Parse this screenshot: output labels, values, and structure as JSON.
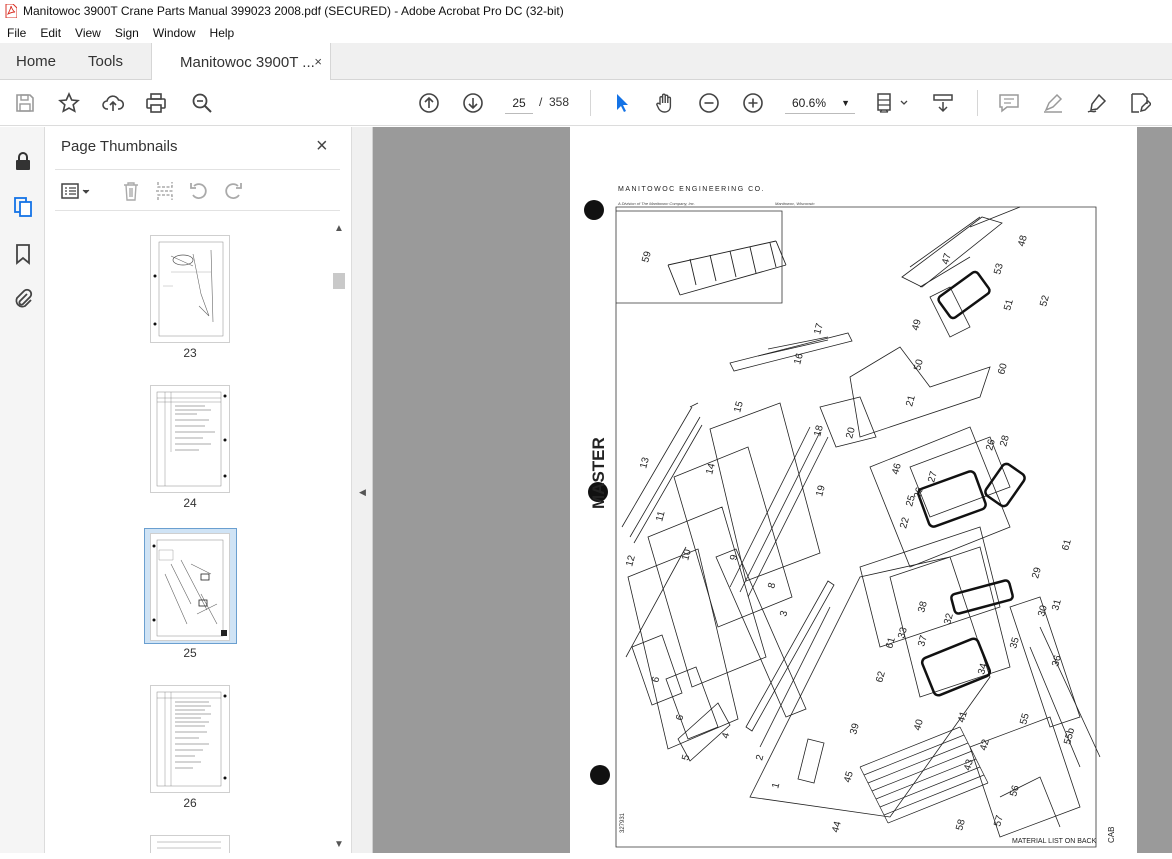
{
  "window": {
    "title": "Manitowoc 3900T Crane Parts Manual 399023 2008.pdf (SECURED) - Adobe Acrobat Pro DC (32-bit)"
  },
  "menu": [
    "File",
    "Edit",
    "View",
    "Sign",
    "Window",
    "Help"
  ],
  "tabs": {
    "home": "Home",
    "tools": "Tools",
    "document": "Manitowoc 3900T ...",
    "close": "×"
  },
  "toolbar": {
    "current_page": "25",
    "page_separator": "/",
    "total_pages": "358",
    "zoom": "60.6%",
    "icons": [
      "save-icon",
      "star-icon",
      "upload-icon",
      "print-icon",
      "search-zoom-icon",
      "page-up-icon",
      "page-down-icon",
      "select-pointer-icon",
      "hand-icon",
      "zoom-out-icon",
      "zoom-in-icon",
      "fit-page-icon",
      "scroll-mode-icon",
      "comment-icon",
      "highlight-icon",
      "sign-icon",
      "edit-pdf-icon"
    ]
  },
  "panel": {
    "title": "Page Thumbnails",
    "close": "×"
  },
  "thumbnails": [
    {
      "label": "23"
    },
    {
      "label": "24"
    },
    {
      "label": "25",
      "selected": true
    },
    {
      "label": "26"
    }
  ],
  "document": {
    "header": "MANITOWOC ENGINEERING CO.",
    "subheader_left": "A Division of The Manitowoc Company, Inc.",
    "subheader_right": "Manitowoc, Wisconsin",
    "stamp": "MASTER",
    "footer_note": "MATERIAL LIST ON BACK",
    "footer_right": "CAB",
    "drawing_number": "327931",
    "part_numbers": [
      "59",
      "17",
      "16",
      "15",
      "14",
      "13",
      "12",
      "11",
      "10",
      "9",
      "8",
      "3",
      "2",
      "1",
      "4",
      "5",
      "6",
      "6",
      "18",
      "19",
      "20",
      "21",
      "22",
      "25",
      "26",
      "27",
      "28",
      "46",
      "26",
      "47",
      "48",
      "49",
      "50",
      "51",
      "52",
      "53",
      "60",
      "61",
      "29",
      "30",
      "31",
      "32",
      "33",
      "34",
      "35",
      "36",
      "37",
      "38",
      "39",
      "40",
      "41",
      "42",
      "43",
      "44",
      "45",
      "55",
      "55b",
      "56",
      "57",
      "58",
      "61",
      "62"
    ]
  }
}
